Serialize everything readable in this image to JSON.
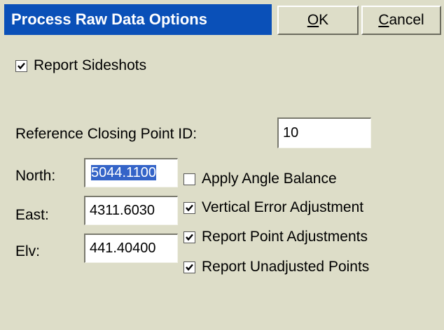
{
  "dialog": {
    "title": "Process Raw Data Options",
    "ok_label": "OK",
    "ok_mnemonic": "O",
    "ok_rest": "K",
    "cancel_mnemonic": "C",
    "cancel_rest": "ancel"
  },
  "options": {
    "report_sideshots": {
      "label": "Report Sideshots",
      "checked": true
    },
    "apply_angle_balance": {
      "label": "Apply Angle Balance",
      "checked": false
    },
    "vertical_error_adjustment": {
      "label": "Vertical Error Adjustment",
      "checked": true
    },
    "report_point_adjustments": {
      "label": "Report Point Adjustments",
      "checked": true
    },
    "report_unadjusted_points": {
      "label": "Report Unadjusted Points",
      "checked": true
    }
  },
  "closing_point": {
    "label": "Reference Closing Point ID:",
    "value": "10"
  },
  "coordinates": {
    "north_label": "North:",
    "north_value": "5044.1100",
    "east_label": "East:",
    "east_value": "4311.6030",
    "elv_label": "Elv:",
    "elv_value": "441.40400"
  },
  "colors": {
    "dialog_bg": "#ddddc8",
    "title_bg": "#0a50b8",
    "selection": "#3464c8"
  }
}
